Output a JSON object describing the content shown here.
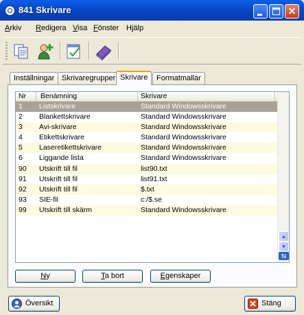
{
  "window": {
    "title": "841 Skrivare"
  },
  "menu": [
    "Arkiv",
    "Redigera",
    "Visa",
    "Fönster",
    "Hjälp"
  ],
  "toolbar": {
    "icons": [
      "copy-document-icon",
      "add-user-icon",
      "edit-note-icon",
      "book-icon"
    ]
  },
  "tabs": [
    {
      "label": "Inställningar",
      "active": false
    },
    {
      "label": "Skrivaregrupper",
      "active": false
    },
    {
      "label": "Skrivare",
      "active": true
    },
    {
      "label": "Formatmallar",
      "active": false
    }
  ],
  "grid": {
    "columns": [
      "Nr",
      "Benämning",
      "Skrivare"
    ],
    "rows": [
      {
        "nr": "1",
        "name": "Listskrivare",
        "printer": "Standard Windowsskrivare",
        "selected": true
      },
      {
        "nr": "2",
        "name": "Blankettskrivare",
        "printer": "Standard Windowsskrivare"
      },
      {
        "nr": "3",
        "name": "Avi-skrivare",
        "printer": "Standard Windowsskrivare"
      },
      {
        "nr": "4",
        "name": "Etikettskrivare",
        "printer": "Standard Windowsskrivare"
      },
      {
        "nr": "5",
        "name": "Laseretikettskrivare",
        "printer": "Standard Windowsskrivare"
      },
      {
        "nr": "6",
        "name": "Liggande lista",
        "printer": "Standard Windowsskrivare"
      },
      {
        "nr": "90",
        "name": "Utskrift till fil",
        "printer": "list90.txt"
      },
      {
        "nr": "91",
        "name": "Utskrift till fil",
        "printer": "list91.txt"
      },
      {
        "nr": "92",
        "name": "Utskrift till fil",
        "printer": "$.txt"
      },
      {
        "nr": "93",
        "name": "SIE-fil",
        "printer": "c:/$.se"
      },
      {
        "nr": "99",
        "name": "Utskrift till skärm",
        "printer": "Standard Windowsskrivare"
      }
    ]
  },
  "buttons": {
    "new": "Ny",
    "delete": "Ta bort",
    "properties": "Egenskaper"
  },
  "footer": {
    "overview": "Översikt",
    "close": "Stäng"
  },
  "colors": {
    "selected_row": "#a8a396",
    "alt_row": "#fdfbe0",
    "title_bar": "#0a5fe8",
    "active_tab_accent": "#ff9c00"
  }
}
